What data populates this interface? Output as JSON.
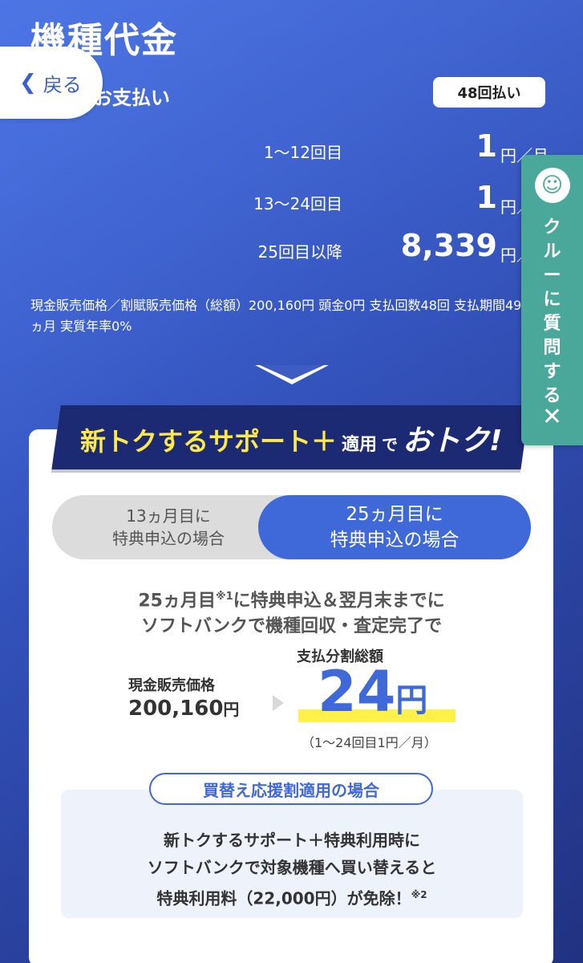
{
  "header": {
    "title": "機種代金",
    "back_label": "戻る",
    "payment_label": "お支払い",
    "installment_badge": "48回払い"
  },
  "schedule": [
    {
      "period": "1〜12回目",
      "amount": "1",
      "unit": "円／月"
    },
    {
      "period": "13〜24回目",
      "amount": "1",
      "unit": "円／月"
    },
    {
      "period": "25回目以降",
      "amount": "8,339",
      "unit": "円／月"
    }
  ],
  "note": "現金販売価格／割賦販売価格（総額）200,160円 頭金0円 支払回数48回 支払期間49ヵ月 実質年率0%",
  "promo": {
    "ribbon_main": "新トクするサポート＋",
    "ribbon_apply": "適用",
    "ribbon_de": "で",
    "ribbon_otoku": "おトク!"
  },
  "toggle": {
    "option_13": [
      "13ヵ月目に",
      "特典申込の場合"
    ],
    "option_25": [
      "25ヵ月目に",
      "特典申込の場合"
    ]
  },
  "condition": {
    "line1_pre": "25ヵ月目",
    "line1_sup": "※1",
    "line1_post": "に特典申込＆翌月末までに",
    "line2": "ソフトバンクで機種回収・査定完了で"
  },
  "price": {
    "cash_label": "現金販売価格",
    "cash_value": "200,160",
    "cash_unit": "円",
    "total_label": "支払分割総額",
    "total_value": "24",
    "total_unit": "円",
    "total_sub": "（1〜24回目1円／月）"
  },
  "plan": {
    "pill": "買替え応援割適用の場合",
    "line1": "新トクするサポート＋特典利用時に",
    "line2": "ソフトバンクで対象機種へ買い替えると",
    "line3": "特典利用料（22,000円）が免除！",
    "line3_sup": "※2"
  },
  "crew": {
    "label": "クルーに質問する",
    "icon": "headset-icon",
    "close": "✕"
  },
  "colors": {
    "primary": "#3f68d8",
    "ribbon": "#1c2a73",
    "highlight": "#ffe94a",
    "crew": "#4aa89a"
  }
}
